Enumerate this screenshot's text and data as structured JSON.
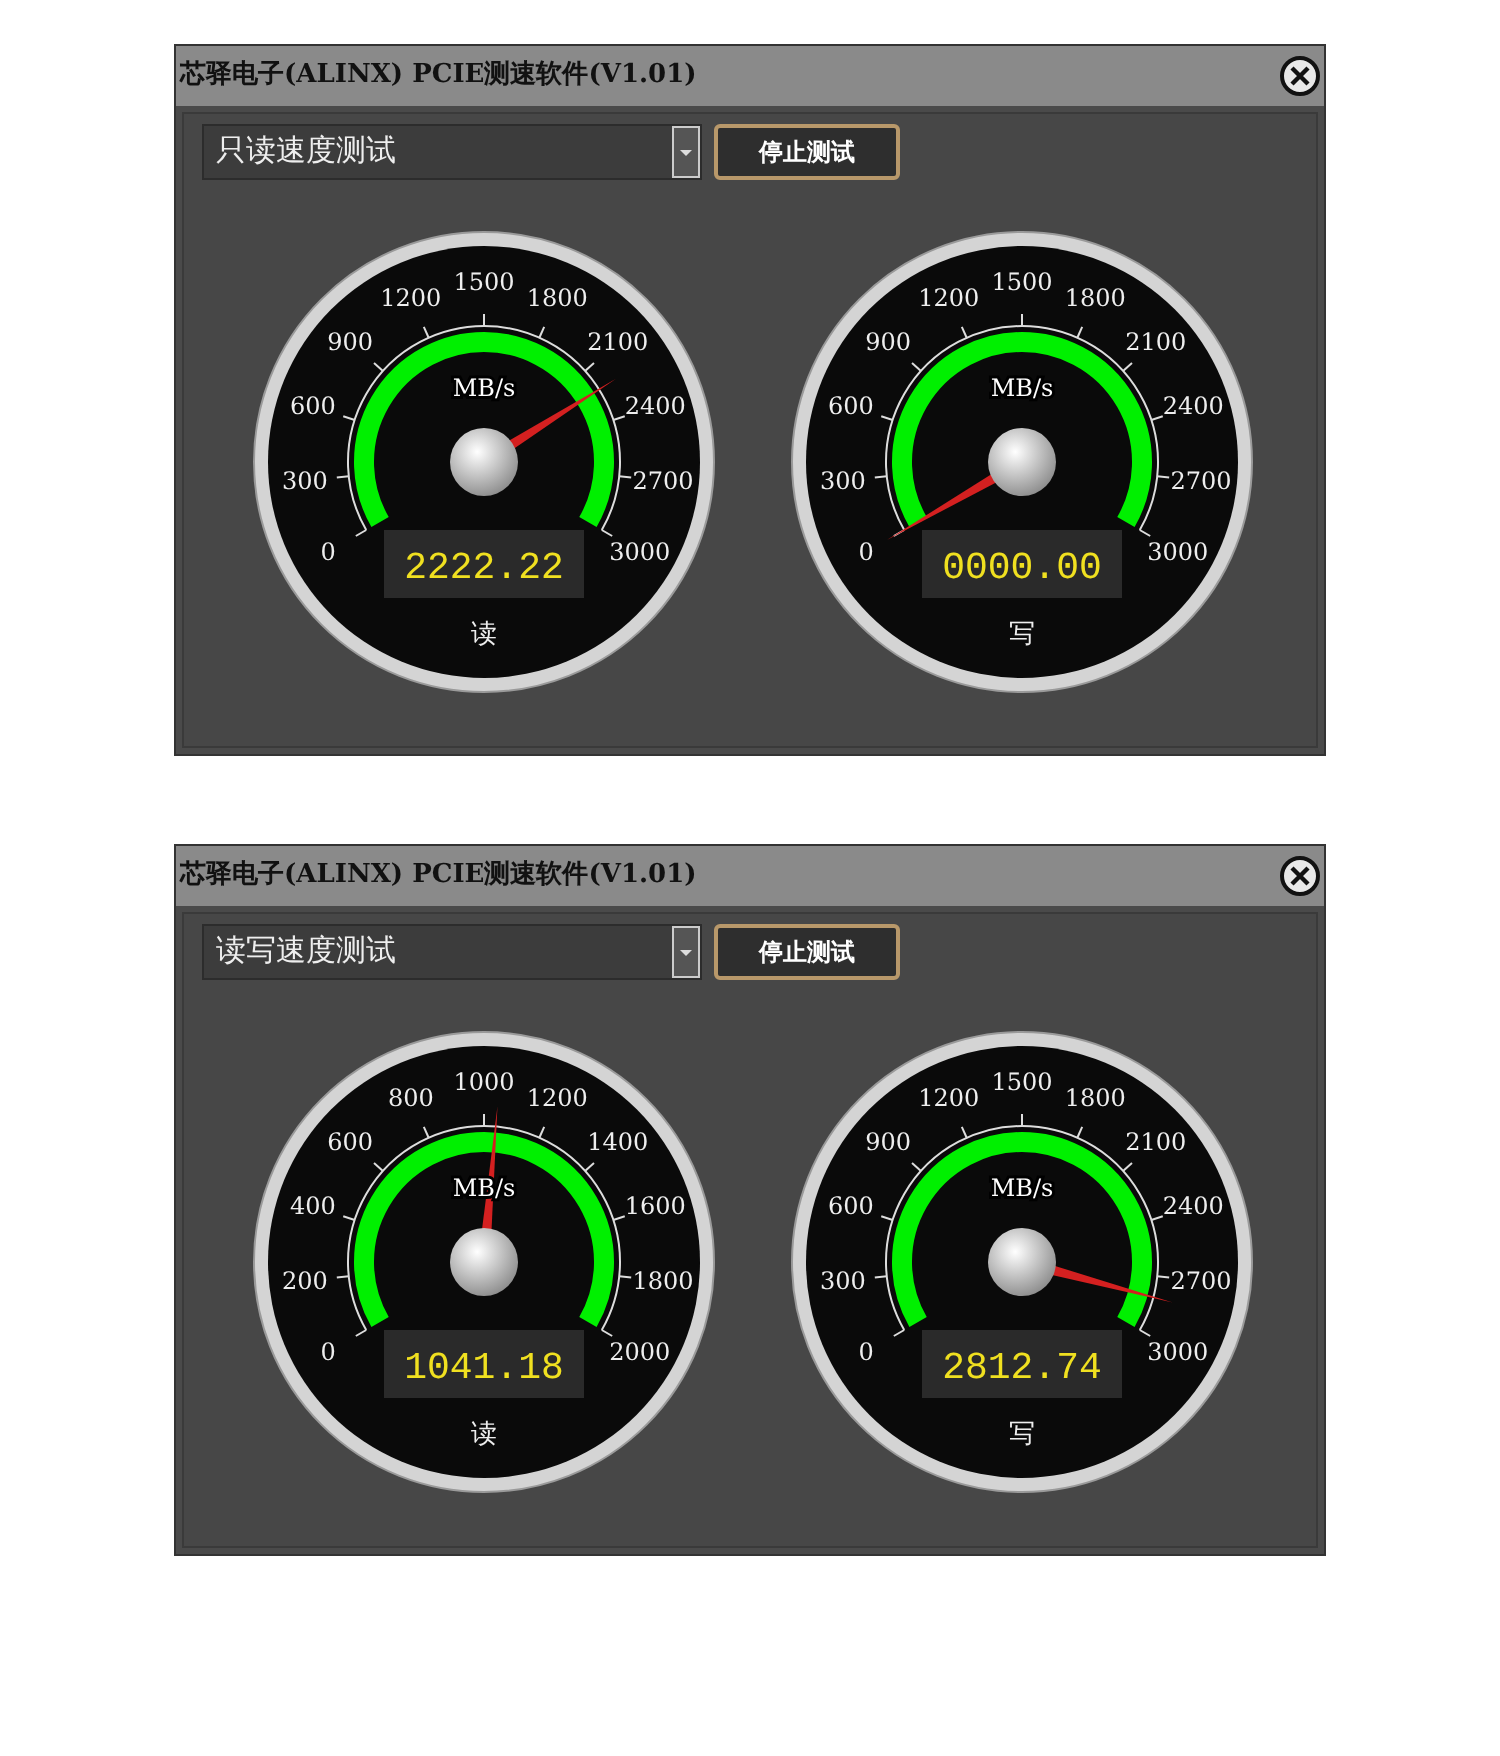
{
  "windows": [
    {
      "title": "芯驿电子(ALINX) PCIE测速软件(V1.01)",
      "mode_dropdown": {
        "value": "只读速度测试"
      },
      "stop_button": "停止测试",
      "gauges": [
        {
          "unit": "MB/s",
          "scale_labels": [
            "1500",
            "1200",
            "1800",
            "900",
            "2100",
            "600",
            "2400",
            "300",
            "2700",
            "0",
            "3000"
          ],
          "readout": "2222.22",
          "label": "读"
        },
        {
          "unit": "MB/s",
          "scale_labels": [
            "1500",
            "1200",
            "1800",
            "900",
            "2100",
            "600",
            "2400",
            "300",
            "2700",
            "0",
            "3000"
          ],
          "readout": "0000.00",
          "label": "写"
        }
      ]
    },
    {
      "title": "芯驿电子(ALINX) PCIE测速软件(V1.01)",
      "mode_dropdown": {
        "value": "读写速度测试"
      },
      "stop_button": "停止测试",
      "gauges": [
        {
          "unit": "MB/s",
          "scale_labels": [
            "1000",
            "800",
            "1200",
            "600",
            "1400",
            "400",
            "1600",
            "200",
            "1800",
            "0",
            "2000"
          ],
          "readout": "1041.18",
          "label": "读"
        },
        {
          "unit": "MB/s",
          "scale_labels": [
            "1500",
            "1200",
            "1800",
            "900",
            "2100",
            "600",
            "2400",
            "300",
            "2700",
            "0",
            "3000"
          ],
          "readout": "2812.74",
          "label": "写"
        }
      ]
    }
  ]
}
